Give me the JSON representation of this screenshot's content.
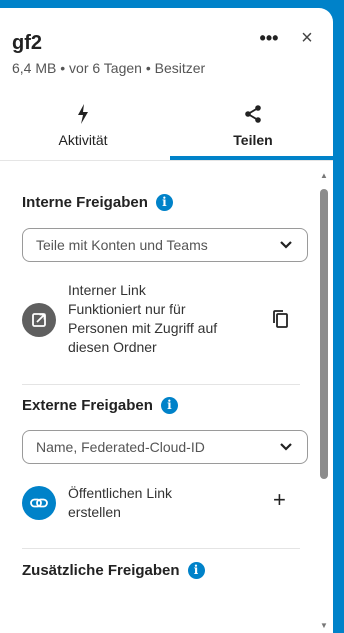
{
  "header": {
    "title": "gf2",
    "subtitle": "6,4 MB • vor 6 Tagen • Besitzer",
    "more_label": "•••",
    "close_label": "×"
  },
  "tabs": [
    {
      "label": "Aktivität",
      "icon": "flash-icon",
      "active": false
    },
    {
      "label": "Teilen",
      "icon": "share-icon",
      "active": true
    }
  ],
  "internal": {
    "title": "Interne Freigaben",
    "select_placeholder": "Teile mit Konten und Teams",
    "link_title": "Interner Link",
    "link_description": [
      "Funktioniert nur für",
      "Personen mit Zugriff auf",
      "diesen Ordner"
    ]
  },
  "external": {
    "title": "Externe Freigaben",
    "select_placeholder": "Name, Federated-Cloud-ID",
    "public_link_label": [
      "Öffentlichen Link",
      "erstellen"
    ],
    "add_label": "+"
  },
  "additional": {
    "title": "Zusätzliche Freigaben"
  },
  "colors": {
    "accent": "#0082c9",
    "internal_link_icon_bg": "#5f5f5f",
    "public_link_icon_bg": "#0082c9"
  }
}
